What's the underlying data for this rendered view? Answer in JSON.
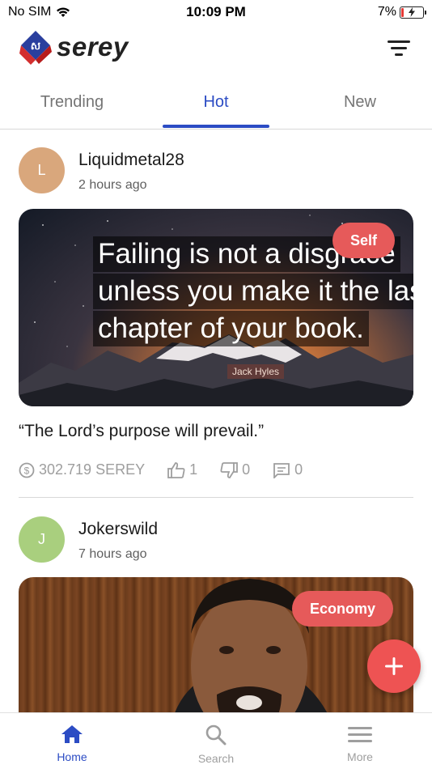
{
  "status_bar": {
    "carrier": "No SIM",
    "time": "10:09 PM",
    "battery": "7%"
  },
  "header": {
    "app_name": "serey"
  },
  "tabs": [
    {
      "label": "Trending"
    },
    {
      "label": "Hot"
    },
    {
      "label": "New"
    }
  ],
  "posts": [
    {
      "avatar_letter": "L",
      "avatar_color": "#d9a77c",
      "author": "Liquidmetal28",
      "time": "2 hours ago",
      "tag": "Self",
      "image_quote": [
        "Failing is not a disgrace",
        "unless you make it the last",
        "chapter of your book."
      ],
      "image_attribution": "Jack Hyles",
      "title": "“The Lord’s purpose will prevail.”",
      "amount": "302.719 SEREY",
      "likes": "1",
      "dislikes": "0",
      "comments": "0"
    },
    {
      "avatar_letter": "J",
      "avatar_color": "#a9cf7e",
      "author": "Jokerswild",
      "time": "7 hours ago",
      "tag": "Economy"
    }
  ],
  "bottom_nav": [
    {
      "label": "Home",
      "icon": "home-icon"
    },
    {
      "label": "Search",
      "icon": "search-icon"
    },
    {
      "label": "More",
      "icon": "menu-icon"
    }
  ],
  "colors": {
    "accent": "#2c4cc4",
    "tag": "#e65a5a",
    "fab": "#ee5353"
  }
}
